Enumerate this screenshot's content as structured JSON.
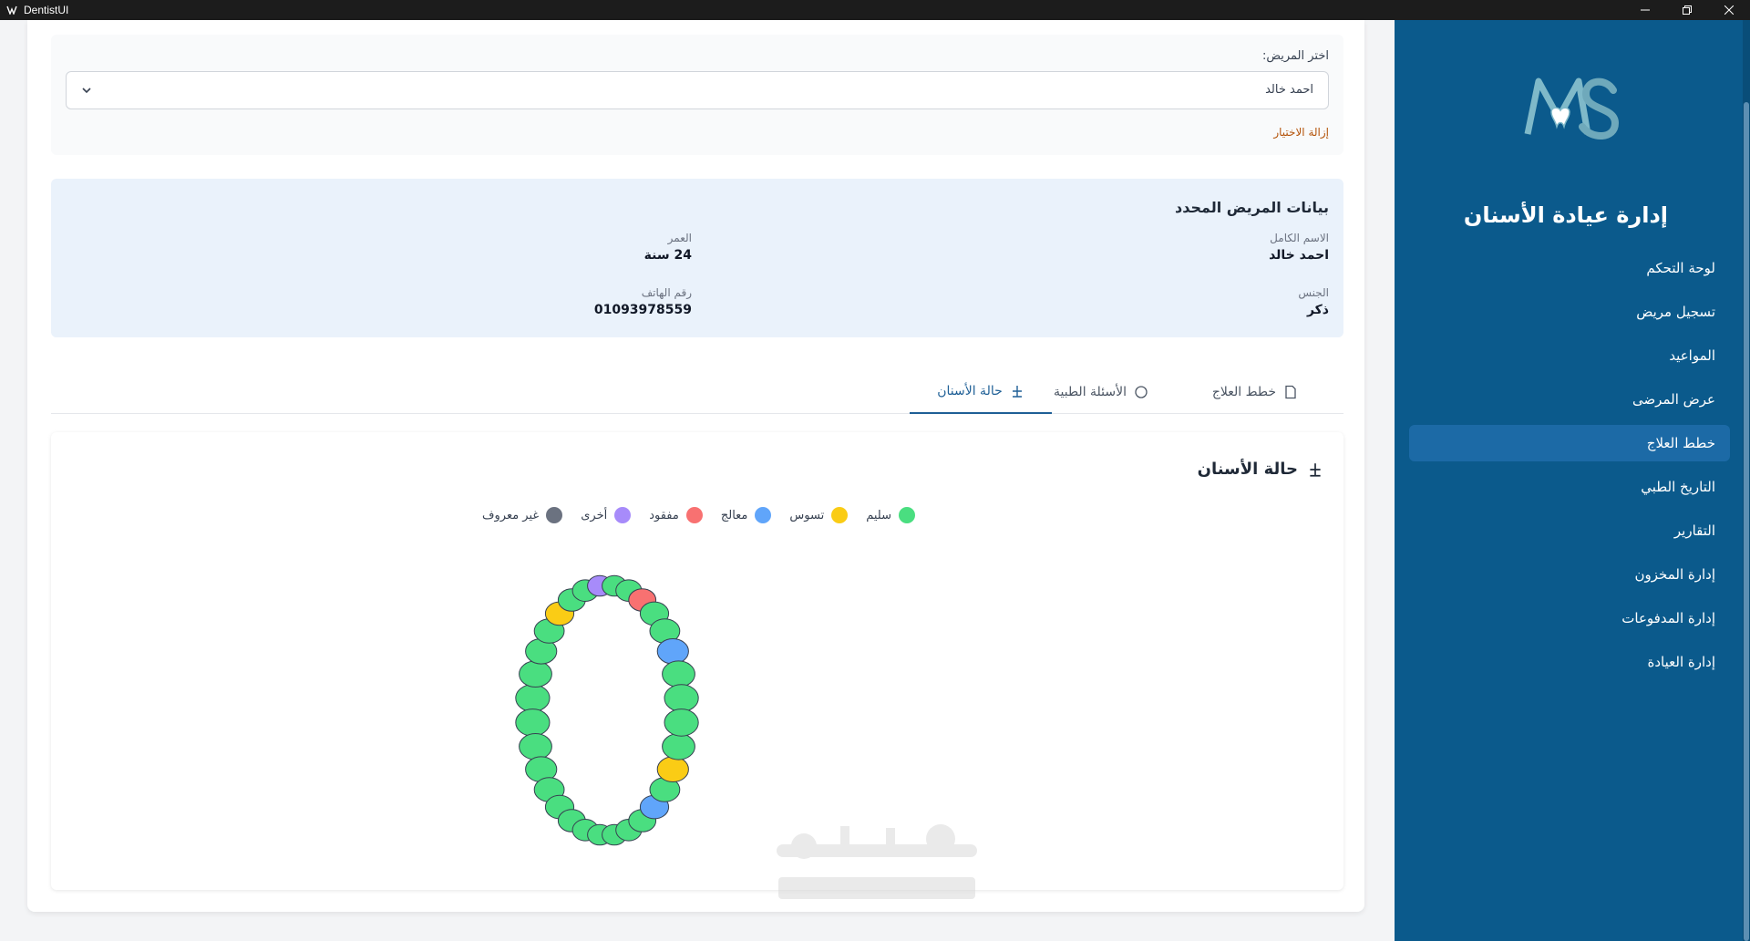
{
  "window": {
    "title": "DentistUI"
  },
  "patient_select": {
    "label": "اختر المريض:",
    "value": "احمد خالد",
    "clear_label": "إزالة الاختيار"
  },
  "patient_info": {
    "title": "بيانات المريض المحدد",
    "full_name_label": "الاسم الكامل",
    "full_name_value": "احمد خالد",
    "age_label": "العمر",
    "age_value": "24 سنة",
    "gender_label": "الجنس",
    "gender_value": "ذكر",
    "phone_label": "رقم الهاتف",
    "phone_value": "01093978559"
  },
  "tabs": [
    {
      "label": "خطط العلاج",
      "icon": "document-icon"
    },
    {
      "label": "الأسئلة الطبية",
      "icon": "circle-icon"
    },
    {
      "label": "حالة الأسنان",
      "icon": "tooth-icon"
    }
  ],
  "active_tab": 2,
  "teeth_chart": {
    "title": "حالة الأسنان",
    "legend": [
      {
        "label": "سليم",
        "color": "#4ade80"
      },
      {
        "label": "تسوس",
        "color": "#facc15"
      },
      {
        "label": "معالج",
        "color": "#60a5fa"
      },
      {
        "label": "مفقود",
        "color": "#f87171"
      },
      {
        "label": "أخرى",
        "color": "#a78bfa"
      },
      {
        "label": "غير معروف",
        "color": "#6b7280"
      }
    ],
    "upper_teeth": [
      "healthy",
      "healthy",
      "healthy",
      "healthy",
      "decay",
      "healthy",
      "healthy",
      "other",
      "healthy",
      "healthy",
      "missing",
      "healthy",
      "healthy",
      "treated",
      "healthy",
      "healthy"
    ],
    "lower_teeth": [
      "healthy",
      "healthy",
      "healthy",
      "healthy",
      "healthy",
      "healthy",
      "healthy",
      "healthy",
      "healthy",
      "healthy",
      "healthy",
      "treated",
      "healthy",
      "decay",
      "healthy",
      "healthy"
    ],
    "status_colors": {
      "healthy": "#4ade80",
      "decay": "#facc15",
      "treated": "#60a5fa",
      "missing": "#f87171",
      "other": "#a78bfa",
      "unknown": "#6b7280"
    }
  },
  "sidebar": {
    "title": "إدارة عيادة الأسنان",
    "items": [
      {
        "label": "لوحة التحكم"
      },
      {
        "label": "تسجيل مريض"
      },
      {
        "label": "المواعيد"
      },
      {
        "label": "عرض المرضى"
      },
      {
        "label": "خطط العلاج"
      },
      {
        "label": "التاريخ الطبي"
      },
      {
        "label": "التقارير"
      },
      {
        "label": "إدارة المخزون"
      },
      {
        "label": "إدارة المدفوعات"
      },
      {
        "label": "إدارة العيادة"
      }
    ],
    "active_index": 4
  }
}
